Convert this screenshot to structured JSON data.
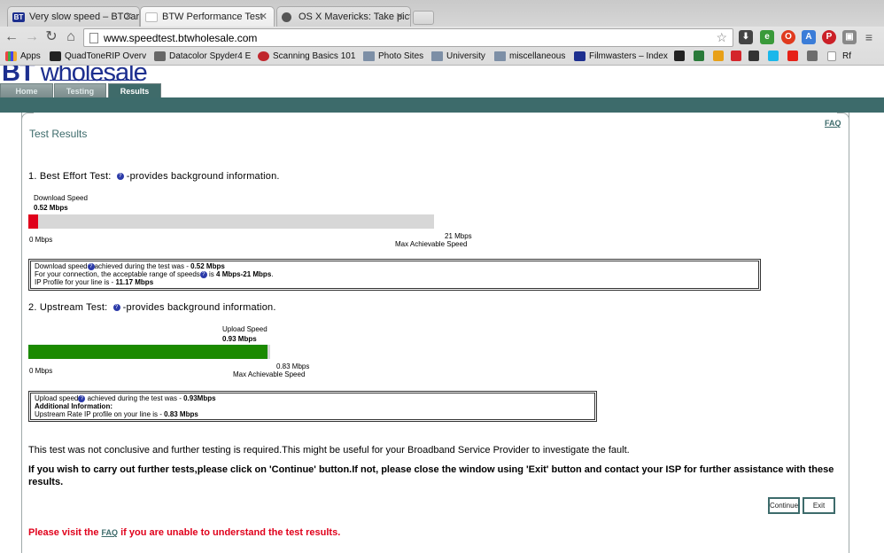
{
  "browser": {
    "tabs": [
      {
        "label": "Very slow speed – BTCare",
        "icon_text": "BT",
        "color": "#1d2f8f"
      },
      {
        "label": "BTW Performance Test",
        "icon_text": "",
        "color": "#ffffff"
      },
      {
        "label": "OS X Mavericks: Take pictu",
        "icon_text": "",
        "color": "#555555"
      }
    ],
    "url": "www.speedtest.btwholesale.com",
    "bookmarks": [
      {
        "label": "Apps"
      },
      {
        "label": "QuadToneRIP Overv"
      },
      {
        "label": "Datacolor Spyder4 E"
      },
      {
        "label": "Scanning Basics 101"
      },
      {
        "label": "Photo Sites"
      },
      {
        "label": "University"
      },
      {
        "label": "miscellaneous"
      },
      {
        "label": "Filmwasters – Index"
      },
      {
        "label": "Rf"
      }
    ]
  },
  "site": {
    "logo_prefix": "BT",
    "logo_text": "wholesale",
    "nav": [
      "Home",
      "Testing",
      "Results"
    ],
    "faq": "FAQ",
    "title": "Test Results",
    "best_effort": {
      "heading": "1. Best Effort Test:",
      "suffix": "-provides background information.",
      "label_top": "Download  Speed",
      "value": "0.52 Mbps",
      "min_label": "0 Mbps",
      "max_value": "21 Mbps",
      "max_caption": "Max Achievable Speed",
      "fill_fraction": 0.025,
      "box": {
        "line1_pre": "Download speed",
        "line1_mid": "achieved during the test was - ",
        "line1_val": "0.52 Mbps",
        "line2_pre": "For your connection, the acceptable range of speeds",
        "line2_mid": " is ",
        "line2_val": "4 Mbps-21 Mbps",
        "line2_end": ".",
        "line3_pre": "IP Profile for your line is - ",
        "line3_val": "11.17 Mbps"
      }
    },
    "upstream": {
      "heading": "2. Upstream Test:",
      "suffix": "-provides background information.",
      "label_top": "Upload Speed",
      "value": "0.93 Mbps",
      "min_label": "0 Mbps",
      "max_value": "0.83 Mbps",
      "max_caption": "Max Achievable Speed",
      "fill_fraction": 0.99,
      "box": {
        "line1_pre": "Upload speed",
        "line1_mid": " achieved during the test was - ",
        "line1_val": "0.93Mbps",
        "line2": "Additional Information:",
        "line3_pre": "Upstream Rate IP profile on your line is - ",
        "line3_val": "0.83 Mbps"
      }
    },
    "note": "This test was not conclusive and further testing is required.This might be useful for your Broadband Service Provider to investigate the fault.",
    "instruction": "If you wish to carry out further tests,please click on 'Continue' button.If not, please close the window using 'Exit' button and contact your ISP for further assistance with these results.",
    "continue_label": "Continue",
    "exit_label": "Exit",
    "visit_pre": "Please visit the ",
    "visit_link": "FAQ",
    "visit_post": " if you are unable to understand the test results.",
    "colors": {
      "teal": "#3d6b6b",
      "download_fill": "#e0001b",
      "upload_fill": "#1b8a00",
      "bt_blue": "#1d2f8f"
    }
  }
}
